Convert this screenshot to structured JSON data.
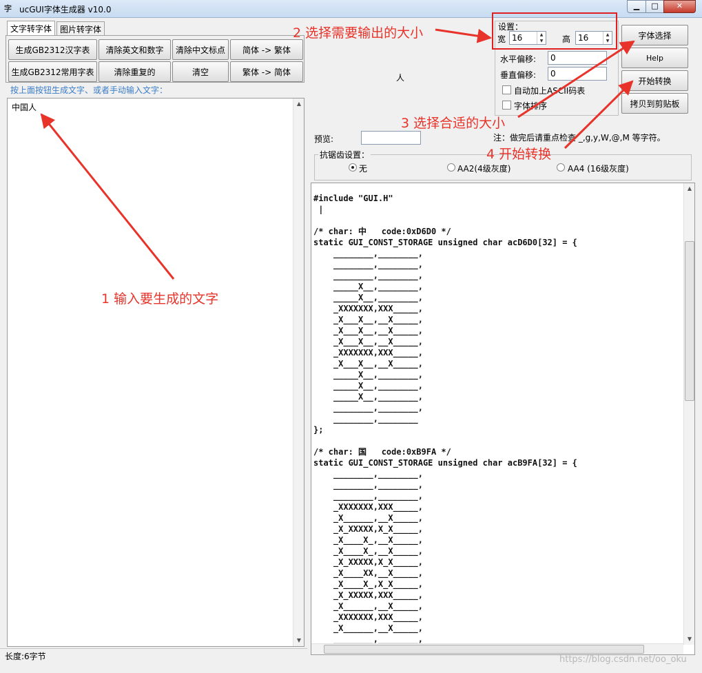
{
  "window": {
    "title": "ucGUI字体生成器 v10.0",
    "icon": "app-icon",
    "min_label": "▁",
    "max_label": "□",
    "close_label": "✕"
  },
  "tabs": [
    "文字转字体",
    "图片转字体"
  ],
  "left_buttons": [
    "生成GB2312汉字表",
    "清除英文和数字",
    "清除中文标点",
    "简体 -> 繁体",
    "生成GB2312常用字表",
    "清除重复的",
    "清空",
    "繁体 -> 简体"
  ],
  "hint": "按上面按钮生成文字、或者手动输入文字：",
  "input_text": "中国人",
  "status": "长度:6字节",
  "preview_glyph": "人",
  "settings": {
    "group_label": "设置：",
    "width_label": "宽",
    "width_value": "16",
    "height_label": "高",
    "height_value": "16",
    "h_offset_label": "水平偏移:",
    "h_offset_value": "0",
    "v_offset_label": "垂直偏移:",
    "v_offset_value": "0",
    "ascii_label": "自动加上ASCII码表",
    "sort_label": "字体排序"
  },
  "right_buttons": [
    "字体选择",
    "Help",
    "开始转换",
    "拷贝到剪贴板"
  ],
  "preview_label": "预览:",
  "note": "注：做完后请重点检查 _,g,y,W,@,M 等字符。",
  "antialias": {
    "label": "抗锯齿设置：",
    "options": [
      "无",
      "AA2(4级灰度)",
      "AA4 (16级灰度)"
    ],
    "selected": "无"
  },
  "code": "#include \"GUI.H\"\n |\n\n/* char: 中   code:0xD6D0 */\nstatic GUI_CONST_STORAGE unsigned char acD6D0[32] = {\n    ________,________,\n    ________,________,\n    ________,________,\n    _____X__,________,\n    _____X__,________,\n    _XXXXXXX,XXX_____,\n    _X___X__,__X_____,\n    _X___X__,__X_____,\n    _X___X__,__X_____,\n    _XXXXXXX,XXX_____,\n    _X___X__,__X_____,\n    _____X__,________,\n    _____X__,________,\n    _____X__,________,\n    ________,________,\n    ________,________\n};\n\n/* char: 国   code:0xB9FA */\nstatic GUI_CONST_STORAGE unsigned char acB9FA[32] = {\n    ________,________,\n    ________,________,\n    ________,________,\n    _XXXXXXX,XXX_____,\n    _X______,__X_____,\n    _X_XXXXX,X_X_____,\n    _X____X_,__X_____,\n    _X____X_,__X_____,\n    _X_XXXXX,X_X_____,\n    _X____XX,__X_____,\n    _X____X_,X_X_____,\n    _X_XXXXX,XXX_____,\n    _X______,__X_____,\n    _XXXXXXX,XXX_____,\n    _X______,__X_____,\n    ________,________,\n    ________,________",
  "annotations": {
    "a1": "1 输入要生成的文字",
    "a2": "2 选择需要输出的大小",
    "a3": "3 选择合适的大小",
    "a4": "4 开始转换"
  },
  "watermark": "https://blog.csdn.net/oo_oku",
  "colors": {
    "annotation": "#e8332a",
    "hint": "#3a7cc8"
  }
}
